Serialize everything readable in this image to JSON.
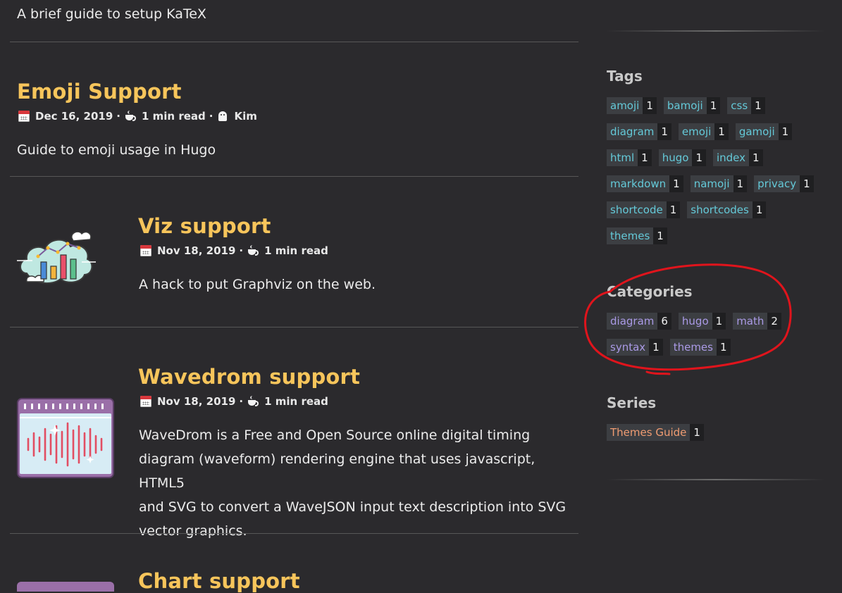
{
  "intro_text": "A brief guide to setup KaTeX",
  "posts": [
    {
      "title": "Emoji Support",
      "date": "Dec 16, 2019",
      "read_time": "1 min read",
      "author": "Kim",
      "summary": "Guide to emoji usage in Hugo",
      "icons": [
        "calendar-icon",
        "coffee-icon",
        "ghost-icon"
      ]
    },
    {
      "title": "Viz support",
      "date": "Nov 18, 2019",
      "read_time": "1 min read",
      "summary": "A hack to put Graphviz on the web.",
      "thumbnail": "cloud-chart-image"
    },
    {
      "title": "Wavedrom support",
      "date": "Nov 18, 2019",
      "read_time": "1 min read",
      "summary_lines": [
        "WaveDrom is a Free and Open Source online digital timing",
        "diagram (waveform) rendering engine that uses javascript, HTML5",
        "and SVG to convert a WaveJSON input text description into SVG",
        "vector graphics."
      ],
      "thumbnail": "waveform-image"
    },
    {
      "title": "Chart support"
    }
  ],
  "meta_separator": "·",
  "sidebar": {
    "tags": {
      "heading": "Tags",
      "rows": [
        [
          {
            "name": "amoji",
            "count": "1"
          },
          {
            "name": "bamoji",
            "count": "1"
          },
          {
            "name": "css",
            "count": "1"
          }
        ],
        [
          {
            "name": "diagram",
            "count": "1"
          },
          {
            "name": "emoji",
            "count": "1"
          },
          {
            "name": "gamoji",
            "count": "1"
          }
        ],
        [
          {
            "name": "html",
            "count": "1"
          },
          {
            "name": "hugo",
            "count": "1"
          },
          {
            "name": "index",
            "count": "1"
          }
        ],
        [
          {
            "name": "markdown",
            "count": "1"
          },
          {
            "name": "namoji",
            "count": "1"
          },
          {
            "name": "privacy",
            "count": "1"
          }
        ],
        [
          {
            "name": "shortcode",
            "count": "1"
          },
          {
            "name": "shortcodes",
            "count": "1"
          }
        ],
        [
          {
            "name": "themes",
            "count": "1"
          }
        ]
      ]
    },
    "categories": {
      "heading": "Categories",
      "rows": [
        [
          {
            "name": "diagram",
            "count": "6"
          },
          {
            "name": "hugo",
            "count": "1"
          },
          {
            "name": "math",
            "count": "2"
          }
        ],
        [
          {
            "name": "syntax",
            "count": "1"
          },
          {
            "name": "themes",
            "count": "1"
          }
        ]
      ]
    },
    "series": {
      "heading": "Series",
      "rows": [
        [
          {
            "name": "Themes Guide",
            "count": "1"
          }
        ]
      ]
    }
  },
  "colors": {
    "background": "#2b2a2d",
    "title": "#f7c55b",
    "tag_text": "#64c9d8",
    "category_text": "#aa9ae6",
    "series_text": "#ef9c72",
    "annotation_circle": "#e0141c"
  }
}
